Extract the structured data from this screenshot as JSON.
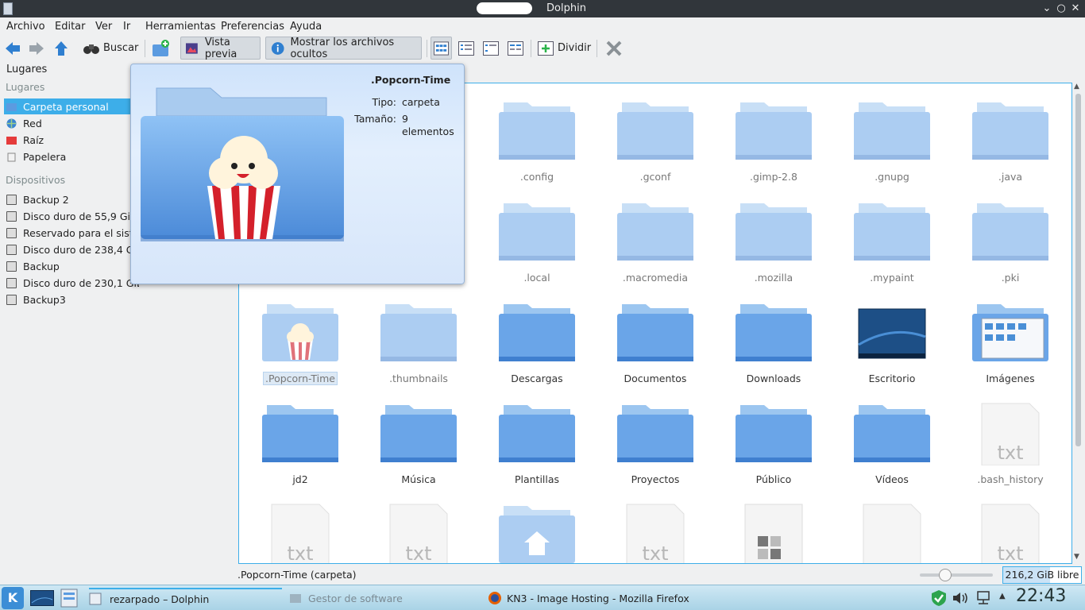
{
  "window": {
    "title": "Dolphin"
  },
  "menu": [
    "Archivo",
    "Editar",
    "Ver",
    "Ir",
    "Herramientas",
    "Preferencias",
    "Ayuda"
  ],
  "toolbar": {
    "search": "Buscar",
    "preview": "Vista previa",
    "show_hidden": "Mostrar los archivos ocultos",
    "split": "Dividir"
  },
  "places": {
    "header": "Lugares",
    "section_places": "Lugares",
    "items": [
      "Carpeta personal",
      "Red",
      "Raíz",
      "Papelera"
    ],
    "section_devices": "Dispositivos",
    "devices": [
      "Backup 2",
      "Disco duro de 55,9 GiB",
      "Reservado para el sistema",
      "Disco duro de 238,4 GiB",
      "Backup",
      "Disco duro de 230,1 GiB",
      "Backup3"
    ]
  },
  "tooltip": {
    "name": ".Popcorn-Time",
    "type_label": "Tipo:",
    "type_value": "carpeta",
    "size_label": "Tamaño:",
    "size_value": "9 elementos"
  },
  "files": [
    {
      "name": ".config",
      "kind": "folder",
      "hidden": true
    },
    {
      "name": ".gconf",
      "kind": "folder",
      "hidden": true
    },
    {
      "name": ".gimp-2.8",
      "kind": "folder",
      "hidden": true
    },
    {
      "name": ".gnupg",
      "kind": "folder",
      "hidden": true
    },
    {
      "name": ".java",
      "kind": "folder",
      "hidden": true
    },
    {
      "name": ".local",
      "kind": "folder",
      "hidden": true
    },
    {
      "name": ".macromedia",
      "kind": "folder",
      "hidden": true
    },
    {
      "name": ".mozilla",
      "kind": "folder",
      "hidden": true
    },
    {
      "name": ".mypaint",
      "kind": "folder",
      "hidden": true
    },
    {
      "name": ".pki",
      "kind": "folder",
      "hidden": true
    },
    {
      "name": ".Popcorn-Time",
      "kind": "popcorn",
      "hidden": true,
      "selected": true
    },
    {
      "name": ".thumbnails",
      "kind": "folder",
      "hidden": true
    },
    {
      "name": "Descargas",
      "kind": "folder"
    },
    {
      "name": "Documentos",
      "kind": "folder"
    },
    {
      "name": "Downloads",
      "kind": "folder"
    },
    {
      "name": "Escritorio",
      "kind": "desktop"
    },
    {
      "name": "Imágenes",
      "kind": "images"
    },
    {
      "name": "jd2",
      "kind": "folder"
    },
    {
      "name": "Música",
      "kind": "folder"
    },
    {
      "name": "Plantillas",
      "kind": "folder"
    },
    {
      "name": "Proyectos",
      "kind": "folder"
    },
    {
      "name": "Público",
      "kind": "folder"
    },
    {
      "name": "Vídeos",
      "kind": "folder"
    },
    {
      "name": ".bash_history",
      "kind": "txt",
      "hidden": true
    },
    {
      "name": "",
      "kind": "txt",
      "hidden": true
    },
    {
      "name": "",
      "kind": "txt",
      "hidden": true
    },
    {
      "name": "",
      "kind": "home",
      "hidden": true
    },
    {
      "name": "",
      "kind": "txt",
      "hidden": true
    },
    {
      "name": "",
      "kind": "grid",
      "hidden": true
    },
    {
      "name": "",
      "kind": "blank",
      "hidden": true
    },
    {
      "name": "",
      "kind": "txt",
      "hidden": true
    }
  ],
  "txt_label": "txt",
  "status": {
    "selection": ".Popcorn-Time (carpeta)",
    "free": "216,2 GiB libre",
    "zoom_fraction": 0.35,
    "free_fraction": 0.6
  },
  "taskbar": {
    "kmenu": "K",
    "tasks": [
      "rezarpado – Dolphin",
      "Gestor de software",
      "KN3 - Image Hosting - Mozilla Firefox"
    ],
    "clock": "22:43"
  },
  "colors": {
    "accent": "#3daee9",
    "titlebar": "#31363b"
  }
}
